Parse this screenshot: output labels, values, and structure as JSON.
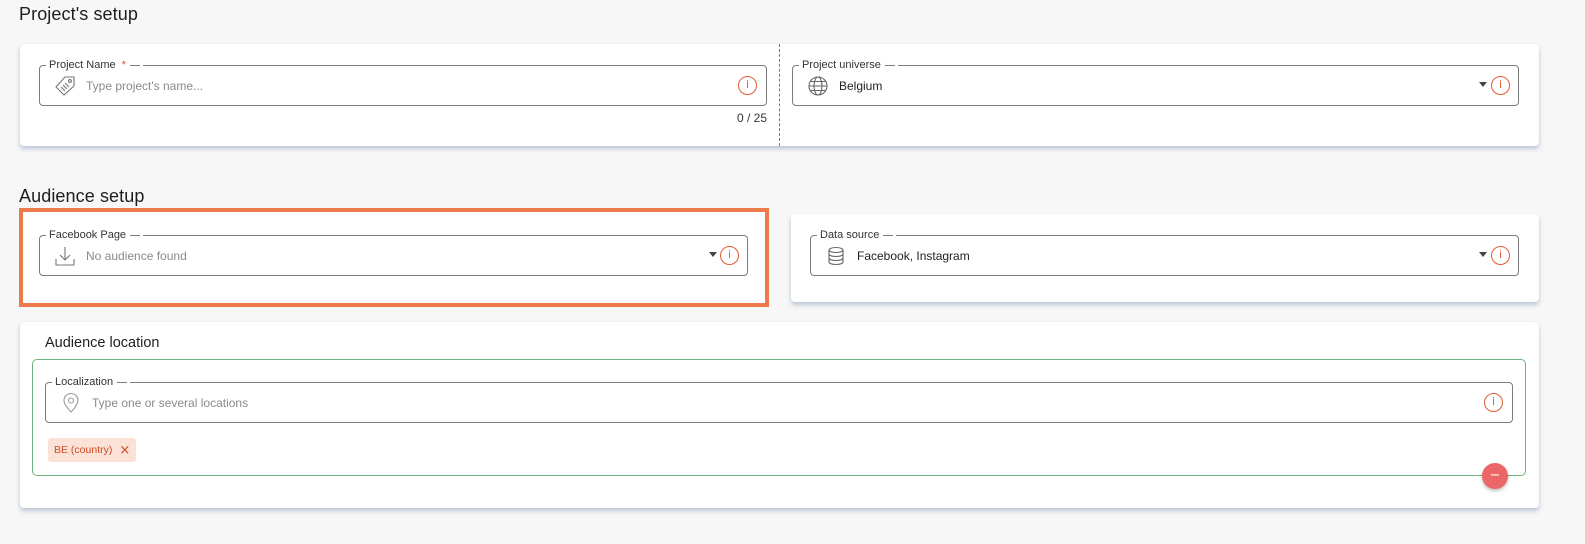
{
  "project_setup": {
    "title": "Project's setup",
    "project_name": {
      "label": "Project Name",
      "required_mark": "*",
      "placeholder": "Type project's name...",
      "counter": "0 / 25"
    },
    "project_universe": {
      "label": "Project universe",
      "value": "Belgium"
    }
  },
  "audience_setup": {
    "title": "Audience setup",
    "facebook_page": {
      "label": "Facebook Page",
      "placeholder": "No audience found"
    },
    "data_source": {
      "label": "Data source",
      "value": "Facebook, Instagram"
    }
  },
  "audience_location": {
    "title": "Audience location",
    "localization": {
      "label": "Localization",
      "placeholder": "Type one or several locations"
    },
    "chips": [
      {
        "label": "BE (country)",
        "remove": "×"
      }
    ],
    "remove_button": "−"
  },
  "icons": {
    "info": "i",
    "project_name": "tag-icon",
    "project_universe": "globe-icon",
    "facebook_page": "download-icon",
    "data_source": "database-icon",
    "localization": "map-pin-icon"
  },
  "colors": {
    "accent": "#e25c34",
    "highlight": "#ec7a4a",
    "chip_bg": "#fbe1d6",
    "remove_btn": "#eb6767",
    "location_border": "#6db37a"
  }
}
